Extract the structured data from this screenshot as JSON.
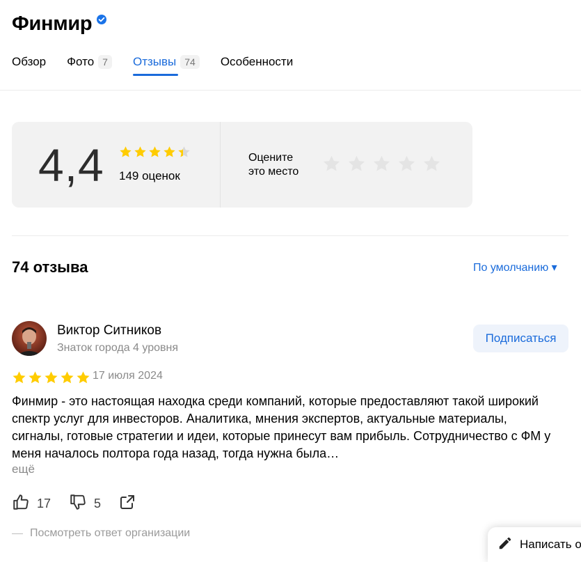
{
  "header": {
    "title": "Финмир"
  },
  "tabs": [
    {
      "label": "Обзор",
      "count": ""
    },
    {
      "label": "Фото",
      "count": "7"
    },
    {
      "label": "Отзывы",
      "count": "74"
    },
    {
      "label": "Особенности",
      "count": ""
    }
  ],
  "active_tab": "Отзывы",
  "rating": {
    "value": "4,4",
    "count_text": "149 оценок",
    "stars": 4.4,
    "rate_label_line1": "Оцените",
    "rate_label_line2": "это место"
  },
  "reviews_header": {
    "count": "74 отзыва",
    "sort": "По умолчанию ▾"
  },
  "review": {
    "author": "Виктор Ситников",
    "level": "Знаток города 4 уровня",
    "subscribe": "Подписаться",
    "stars": 5,
    "date": "17 июля 2024",
    "text": "Финмир - это настоящая находка среди компаний, которые предоставляют такой широкий спектр услуг для инвесторов. Аналитика, мнения экспертов, актуальные материалы, сигналы, готовые стратегии и идеи, которые принесут вам прибыль. Сотрудничество с ФМ у меня началось полтора года назад, тогда нужна была…",
    "more": "ещё",
    "likes": "17",
    "dislikes": "5",
    "org_answer": "Посмотреть ответ организации"
  },
  "write_button": "Написать о",
  "colors": {
    "accent": "#1a6bdb",
    "star": "#fc0",
    "star_empty": "#e0e0e0",
    "card_bg": "#f2f2f2"
  },
  "icons": [
    "verified-icon",
    "star-icon",
    "thumbs-up-icon",
    "thumbs-down-icon",
    "share-icon",
    "pencil-icon"
  ]
}
